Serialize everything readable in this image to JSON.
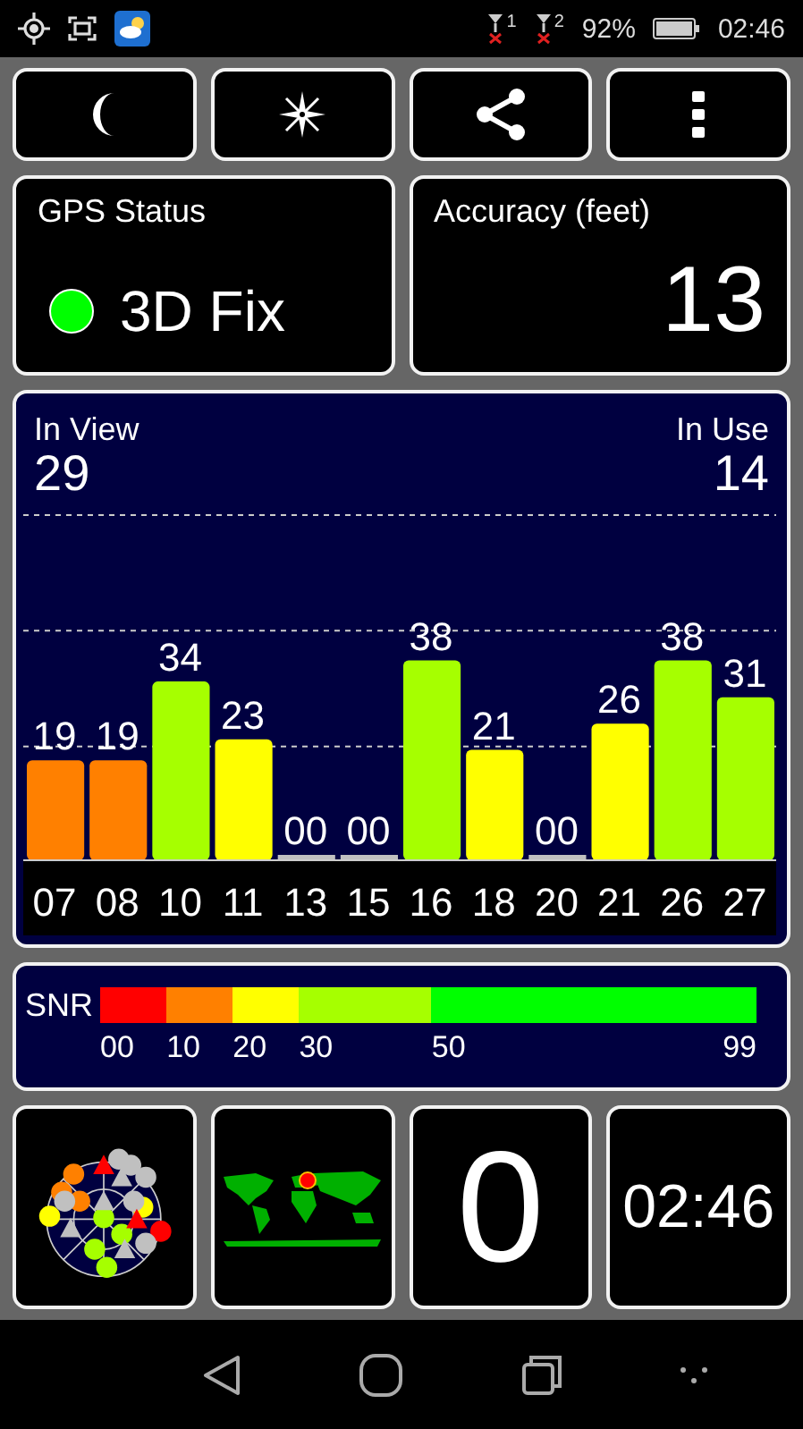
{
  "status_bar": {
    "sims": [
      {
        "label": "1"
      },
      {
        "label": "2"
      }
    ],
    "battery": "92%",
    "time": "02:46"
  },
  "gps_status": {
    "title": "GPS Status",
    "fix": "3D Fix"
  },
  "accuracy": {
    "title": "Accuracy (feet)",
    "value": "13"
  },
  "satellites": {
    "in_view_label": "In View",
    "in_view": "29",
    "in_use_label": "In Use",
    "in_use": "14",
    "chart_data": {
      "type": "bar",
      "categories": [
        "07",
        "08",
        "10",
        "11",
        "13",
        "15",
        "16",
        "18",
        "20",
        "21",
        "26",
        "27"
      ],
      "values": [
        19,
        19,
        34,
        23,
        0,
        0,
        38,
        21,
        0,
        26,
        38,
        31
      ],
      "value_labels": [
        "19",
        "19",
        "34",
        "23",
        "00",
        "00",
        "38",
        "21",
        "00",
        "26",
        "38",
        "31"
      ]
    }
  },
  "snr": {
    "label": "SNR",
    "segments": [
      {
        "from": "00",
        "color": "#ff0000"
      },
      {
        "from": "10",
        "color": "#ff8000"
      },
      {
        "from": "20",
        "color": "#ffff00"
      },
      {
        "from": "30",
        "color": "#a6ff00"
      },
      {
        "from": "50",
        "color": "#00ff00"
      }
    ],
    "end": "99"
  },
  "tiles": {
    "count": "0",
    "clock": "02:46"
  }
}
